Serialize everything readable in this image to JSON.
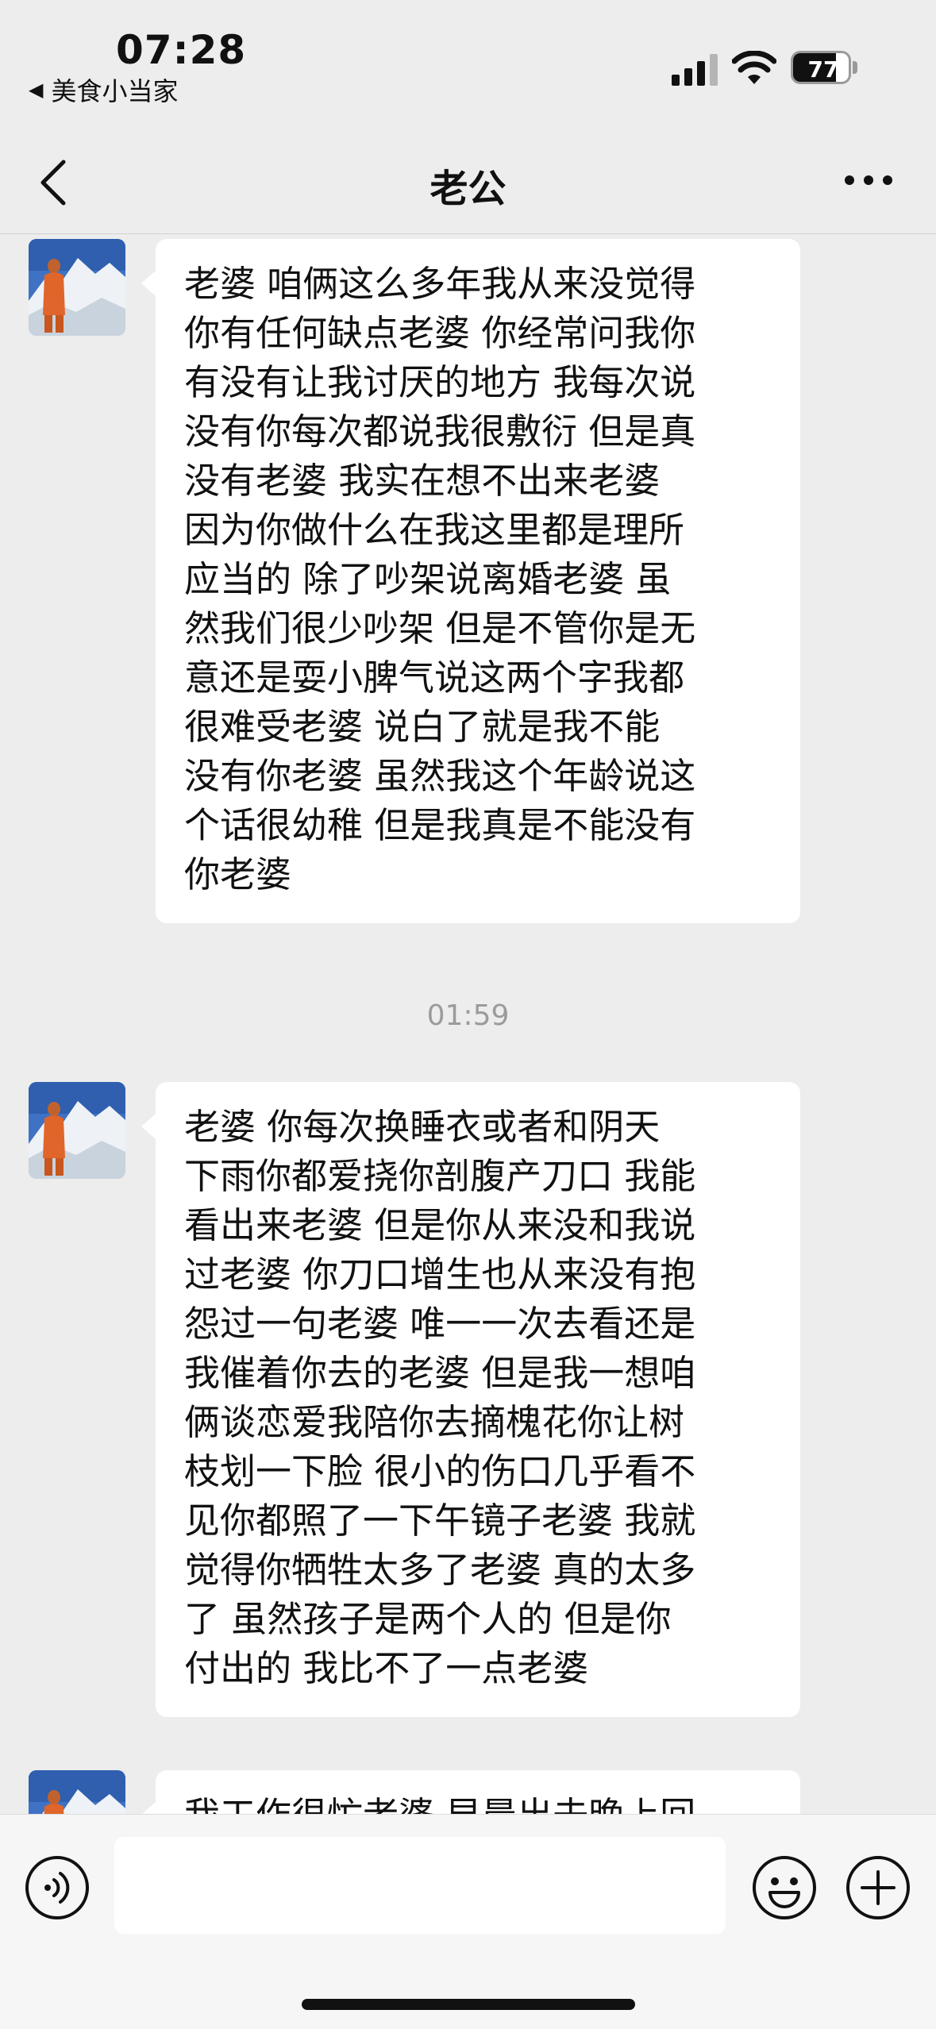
{
  "status_bar": {
    "time": "07:28",
    "back_app_label": "美食小当家",
    "battery_level": "77"
  },
  "nav": {
    "title": "老公"
  },
  "messages": [
    {
      "text": "老婆 咱俩这么多年我从来没觉得\n你有任何缺点老婆 你经常问我你\n有没有让我讨厌的地方 我每次说\n没有你每次都说我很敷衍 但是真\n没有老婆 我实在想不出来老婆\n因为你做什么在我这里都是理所\n应当的 除了吵架说离婚老婆 虽\n然我们很少吵架 但是不管你是无\n意还是耍小脾气说这两个字我都\n很难受老婆  说白了就是我不能\n没有你老婆 虽然我这个年龄说这\n个话很幼稚 但是我真是不能没有\n你老婆"
    },
    {
      "text": "老婆  你每次换睡衣或者和阴天\n下雨你都爱挠你剖腹产刀口 我能\n看出来老婆 但是你从来没和我说\n过老婆 你刀口增生也从来没有抱\n怨过一句老婆 唯一一次去看还是\n我催着你去的老婆 但是我一想咱\n俩谈恋爱我陪你去摘槐花你让树\n枝划一下脸 很小的伤口几乎看不\n见你都照了一下午镜子老婆 我就\n觉得你牺牲太多了老婆 真的太多\n了 虽然孩子是两个人的 但是你\n付出的 我比不了一点老婆"
    },
    {
      "text": "我工作很忙老婆 早晨出去晚上回"
    }
  ],
  "timestamp": "01:59",
  "colors": {
    "background": "#ededed",
    "bubble": "#ffffff",
    "input_bar": "#f6f6f6",
    "timestamp_text": "#9b9b9b"
  },
  "icons": {
    "status_back": "back-triangle-icon",
    "signal": "signal-icon",
    "wifi": "wifi-icon",
    "battery": "battery-icon",
    "nav_back": "chevron-left-icon",
    "more": "more-dots-icon",
    "voice": "voice-icon",
    "emoji": "emoji-icon",
    "plus": "plus-icon"
  }
}
